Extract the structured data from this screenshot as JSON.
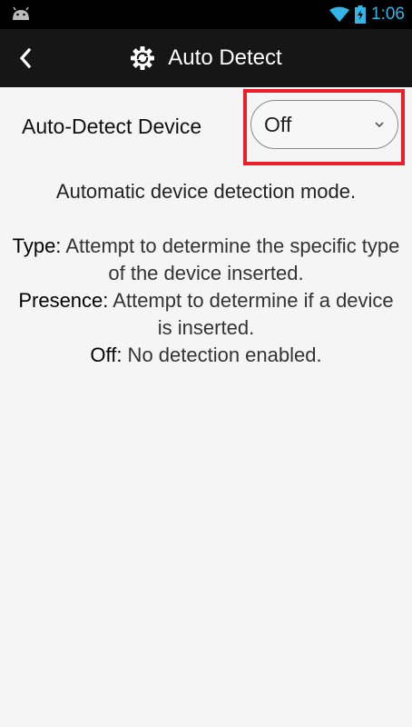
{
  "status_bar": {
    "time": "1:06",
    "icons": [
      "android-icon",
      "wifi-icon",
      "battery-charging-icon"
    ]
  },
  "action_bar": {
    "back_icon": "chevron-left-icon",
    "title_icon": "gear-icon",
    "title": "Auto Detect"
  },
  "setting": {
    "label": "Auto-Detect Device",
    "dropdown_value": "Off",
    "dropdown_icon": "chevron-down-icon"
  },
  "description": {
    "intro": "Automatic device detection mode.",
    "options": [
      {
        "term": "Type:",
        "text": " Attempt to determine the specific type of the device inserted."
      },
      {
        "term": "Presence:",
        "text": " Attempt to determine if a device is inserted."
      },
      {
        "term": "Off:",
        "text": " No detection enabled."
      }
    ]
  },
  "colors": {
    "status_accent": "#33b5e5",
    "action_bar_bg": "#161616",
    "highlight": "#e8202a",
    "background": "#f5f5f5"
  }
}
